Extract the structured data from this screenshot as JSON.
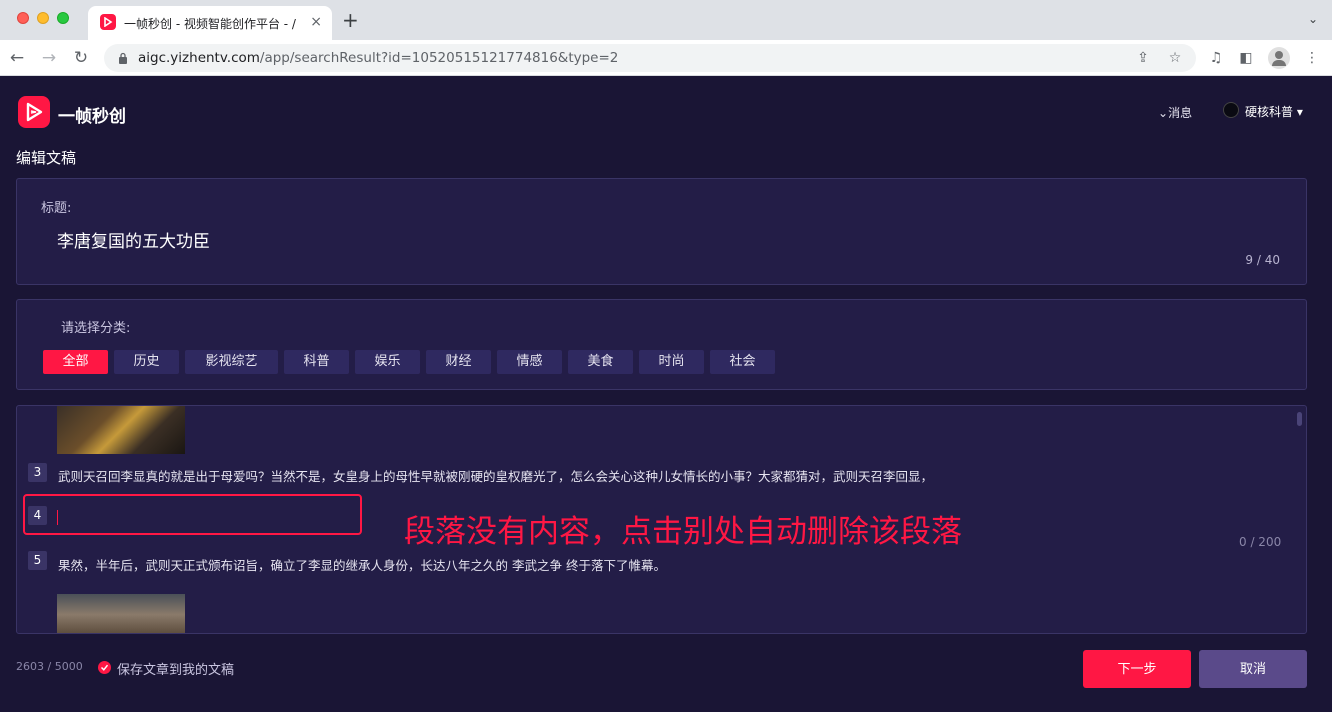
{
  "browser": {
    "tab_title": "一帧秒创 - 视频智能创作平台 - /",
    "tab_close": "×",
    "new_tab": "+",
    "url_host": "aigc.yizhentv.com",
    "url_path": "/app/searchResult?id=10520515121774816&type=2"
  },
  "header": {
    "brand": "一帧秒创",
    "messages": "消息",
    "user": "硬核科普"
  },
  "page_title": "编辑文稿",
  "title_section": {
    "label": "标题:",
    "value": "李唐复国的五大功臣",
    "count": "9 / 40"
  },
  "category_section": {
    "label": "请选择分类:",
    "chips": [
      "全部",
      "历史",
      "影视综艺",
      "科普",
      "娱乐",
      "财经",
      "情感",
      "美食",
      "时尚",
      "社会"
    ]
  },
  "paragraphs": [
    {
      "num": "3",
      "text": "武则天召回李显真的就是出于母爱吗？当然不是，女皇身上的母性早就被刚硬的皇权磨光了，怎么会关心这种儿女情长的小事？大家都猜对，武则天召李回显，"
    },
    {
      "num": "4",
      "text": ""
    },
    {
      "num": "5",
      "text": "果然，半年后，武则天正式颁布诏旨，确立了李显的继承人身份，长达八年之久的 李武之争 终于落下了帷幕。"
    }
  ],
  "paragraph_count": "0 / 200",
  "annotation": "段落没有内容，点击别处自动删除该段落",
  "footer": {
    "total_count": "2603 / 5000",
    "save_label": "保存文章到我的文稿",
    "next_button": "下一步",
    "cancel_button": "取消"
  },
  "colors": {
    "accent": "#ff1744",
    "background": "#1a1535",
    "panel": "#231d47",
    "chip": "#2f2960",
    "cancel": "#5a4a8a"
  }
}
